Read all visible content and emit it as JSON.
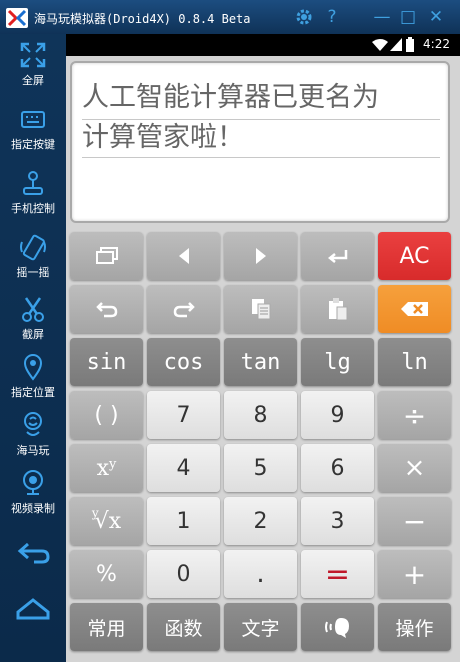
{
  "window": {
    "title": "海马玩模拟器(Droid4X) 0.8.4 Beta",
    "buttons": {
      "settings_icon": "gear-icon",
      "help_label": "?",
      "minimize_label": "—",
      "maximize_label": "□",
      "close_label": "✕"
    }
  },
  "sidebar": {
    "items": [
      {
        "label": "全屏",
        "icon": "fullscreen-icon"
      },
      {
        "label": "指定按键",
        "icon": "keyboard-icon"
      },
      {
        "label": "手机控制",
        "icon": "joystick-icon"
      },
      {
        "label": "摇一摇",
        "icon": "shake-icon"
      },
      {
        "label": "截屏",
        "icon": "scissors-icon"
      },
      {
        "label": "指定位置",
        "icon": "location-pin-icon"
      },
      {
        "label": "海马玩",
        "icon": "seahorse-icon"
      },
      {
        "label": "视频录制",
        "icon": "webcam-icon"
      }
    ],
    "back_icon": "back-arrow-icon",
    "home_icon": "home-icon"
  },
  "status_bar": {
    "time": "4:22",
    "icons": [
      "wifi-icon",
      "signal-icon",
      "battery-icon"
    ]
  },
  "display": {
    "line1": "人工智能计算器已更名为",
    "line2": "计算管家啦！"
  },
  "keys": {
    "row1": [
      "window-icon",
      "left-arrow-icon",
      "right-arrow-icon",
      "enter-icon",
      "AC"
    ],
    "row2": [
      "undo-icon",
      "redo-icon",
      "copy-icon",
      "paste-icon",
      "backspace-icon"
    ],
    "row3": [
      "sin",
      "cos",
      "tan",
      "lg",
      "ln"
    ],
    "row4": [
      "( )",
      "7",
      "8",
      "9",
      "÷"
    ],
    "row5": [
      "x",
      "y",
      "4",
      "5",
      "6",
      "×"
    ],
    "row6": [
      "y",
      "√x",
      "1",
      "2",
      "3",
      "−"
    ],
    "row7": [
      "%",
      "0",
      ".",
      "=",
      "+"
    ],
    "row8": [
      "常用",
      "函数",
      "文字",
      "voice-icon",
      "操作"
    ]
  },
  "colors": {
    "ac": "#d82b2b",
    "backspace": "#ef8c25",
    "equals": "#c0182a",
    "sidebar": "#0f3459"
  }
}
